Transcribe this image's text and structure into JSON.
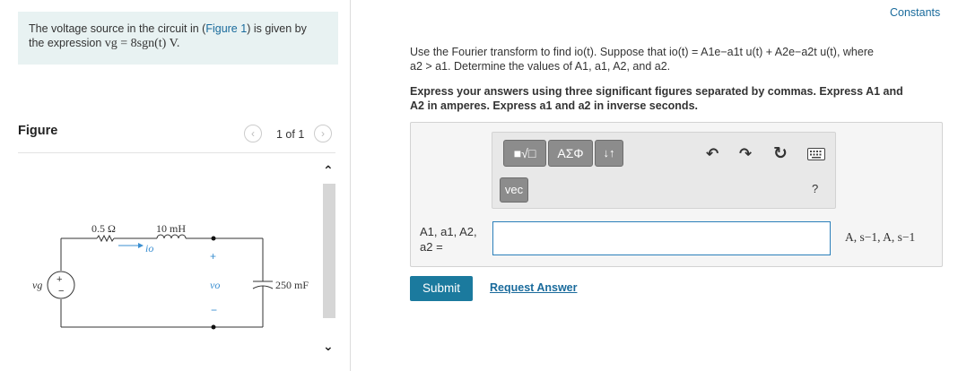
{
  "problem": {
    "prefix": "The voltage source in the circuit in (",
    "figure_link": "Figure 1",
    "suffix": ") is given by",
    "line2_prefix": "the expression ",
    "expression": "vg = 8sgn(t) V."
  },
  "figure": {
    "label": "Figure",
    "page_indicator": "1 of 1",
    "prev_icon": "chevron-left-icon",
    "next_icon": "chevron-right-icon",
    "circuit": {
      "resistor_label": "0.5 Ω",
      "inductor_label": "10 mH",
      "current_label": "io",
      "source_label": "vg",
      "capacitor_label": "250 mF",
      "output_label": "vo",
      "plus": "+",
      "minus": "−"
    }
  },
  "header": {
    "constants_link": "Constants"
  },
  "question": {
    "line1": "Use the Fourier transform to find io(t). Suppose that io(t) = A1e−a1t u(t) + A2e−a2t u(t), where",
    "line2": "a2 > a1. Determine the values of A1, a1, A2, and a2."
  },
  "instructions": {
    "line1": "Express your answers using three significant figures separated by commas. Express A1 and",
    "line2": "A2 in amperes. Express a1 and a2 in inverse seconds."
  },
  "toolbar": {
    "templates_button": "■√□",
    "symbols_button": "ΑΣΦ",
    "sort_button": "↓↑",
    "vec_button": "vec",
    "undo_icon": "undo-icon",
    "redo_icon": "redo-icon",
    "reset_icon": "reset-icon",
    "keyboard_icon": "keyboard-icon",
    "help_label": "?"
  },
  "answer": {
    "label": "A1, a1, A2, a2 =",
    "value": "",
    "units": "A, s−1, A, s−1"
  },
  "actions": {
    "submit_label": "Submit",
    "request_answer_label": "Request Answer"
  }
}
